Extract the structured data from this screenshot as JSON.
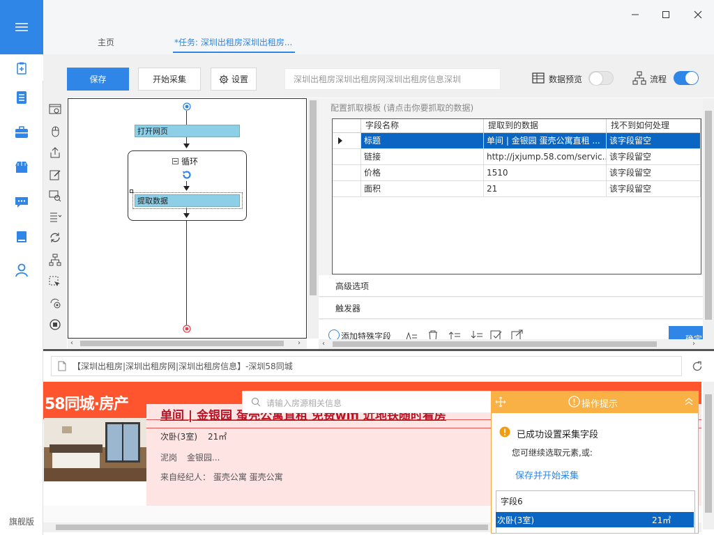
{
  "app": {
    "edition": "旗舰版"
  },
  "tabs": {
    "home": "主页",
    "task": "*任务: 深圳出租房深圳出租房..."
  },
  "toolbar": {
    "save": "保存",
    "start": "开始采集",
    "settings": "设置",
    "task_title": "深圳出租房深圳出租房网深圳出租房信息深圳",
    "data_preview": "数据预览",
    "flow": "流程",
    "data_preview_on": false,
    "flow_on": true
  },
  "workflow": {
    "open_page": "打开网页",
    "loop": "循环",
    "extract": "提取数据"
  },
  "panel": {
    "template_hint": "配置抓取模板 (请点击你要抓取的数据)",
    "columns": [
      "字段名称",
      "提取到的数据",
      "找不到如何处理"
    ],
    "rows": [
      {
        "name": "标题",
        "value": "单间 | 金银园 蛋壳公寓直租 ...",
        "missing": "该字段留空"
      },
      {
        "name": "链接",
        "value": "http://jxjump.58.com/servic...",
        "missing": "该字段留空"
      },
      {
        "name": "价格",
        "value": "1510",
        "missing": "该字段留空"
      },
      {
        "name": "面积",
        "value": "21",
        "missing": "该字段留空"
      }
    ],
    "advanced": "高级选项",
    "trigger": "触发器",
    "add_field": "添加特殊字段",
    "confirm": "确定"
  },
  "browser": {
    "url_title": "【深圳出租房|深圳出租房网|深圳出租房信息】-深圳58同城",
    "site_logo": "58同城·房产",
    "search_placeholder": "请输入房源相关信息",
    "listing": {
      "title": "单间 | 金银园 蛋壳公寓直租 免费wifi 近地铁随时看房",
      "room": "次卧(3室)",
      "area": "21㎡",
      "district": "泥岗",
      "estate": "金银园...",
      "agent": "来自经纪人：  蛋壳公寓 蛋壳公寓"
    }
  },
  "tip": {
    "header": "操作提示",
    "success": "已成功设置采集字段",
    "continue": "您可继续选取元素,或:",
    "save_start": "保存并开始采集",
    "field_label": "字段6",
    "selected_text": "次卧(3室)",
    "selected_value": "21㎡"
  },
  "colors": {
    "accent": "#2f86e6",
    "highlight": "#8ecfe8",
    "brand_orange": "#ff552e",
    "tip_header": "#f9b146"
  }
}
